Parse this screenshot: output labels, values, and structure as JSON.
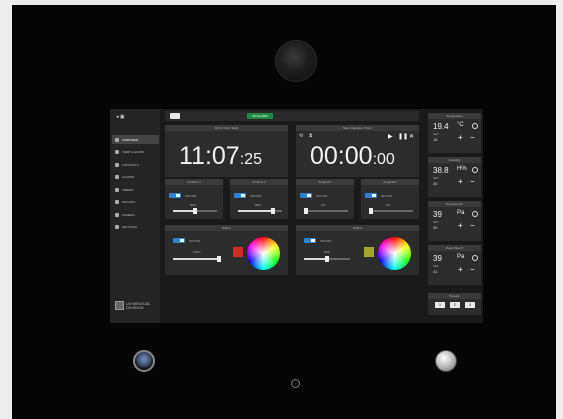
{
  "sidebar": {
    "items": [
      {
        "label": "OVERVIEW",
        "icon": "home-icon",
        "active": true
      },
      {
        "label": "TEMP & HUMID",
        "icon": "thermometer-icon",
        "active": false
      },
      {
        "label": "CONTROLS",
        "icon": "sliders-icon",
        "active": false
      },
      {
        "label": "ALARMS",
        "icon": "warning-icon",
        "active": false
      },
      {
        "label": "TIMERS",
        "icon": "clock-icon",
        "active": false
      },
      {
        "label": "GROUPS",
        "icon": "group-icon",
        "active": false
      },
      {
        "label": "CAMERA",
        "icon": "camera-icon",
        "active": false
      },
      {
        "label": "SETTINGS",
        "icon": "gear-icon",
        "active": false
      }
    ],
    "logo_text": "LM MEDICAL DIVISION"
  },
  "topbar": {
    "alarm_status": "NO ALARM"
  },
  "clock": {
    "title": "FRI 17 MAY 2024",
    "time": "11:07",
    "seconds": ":25"
  },
  "timer": {
    "title": "Main Operation Timer",
    "time": "00:00",
    "seconds": ":00"
  },
  "lights": [
    {
      "title": "Ambient 1",
      "state": "OFF/ON",
      "level_text": "50%",
      "level": 0.5
    },
    {
      "title": "Ambient 2",
      "state": "OFF/ON",
      "level_text": "80%",
      "level": 0.8
    },
    {
      "title": "Surgical 1",
      "state": "OFF/ON",
      "level_text": "0%",
      "level": 0.0
    },
    {
      "title": "Surgical 2",
      "state": "OFF/ON",
      "level_text": "0%",
      "level": 0.0
    }
  ],
  "rgb": [
    {
      "title": "RGB 1",
      "state": "OFF/ON",
      "level_text": "100%",
      "level": 1.0,
      "color": "#d42a2a"
    },
    {
      "title": "RGB 2",
      "state": "OFF/ON",
      "level_text": "50%",
      "level": 0.5,
      "color": "#a5a52a"
    }
  ],
  "readouts": [
    {
      "title": "Temperature",
      "value": "19.4",
      "unit": "°C",
      "icon": "thermometer-icon",
      "set_label": "SET",
      "set_value": "18"
    },
    {
      "title": "Humidity",
      "value": "38.8",
      "unit": "H%",
      "icon": "droplet-icon",
      "set_label": "SET",
      "set_value": "30"
    },
    {
      "title": "Pressure P1",
      "value": "39",
      "unit": "Pa",
      "icon": "gauge-icon",
      "set_label": "SET",
      "set_value": "30"
    },
    {
      "title": "Press Wev P",
      "value": "39",
      "unit": "Pa",
      "icon": "gauge-icon",
      "set_label": "SET",
      "set_value": "41"
    }
  ],
  "presets": {
    "title": "Presets",
    "items": [
      "1",
      "2",
      "3"
    ]
  },
  "colors": {
    "accent": "#2d82d6",
    "alarm_ok": "#1f8a43"
  }
}
